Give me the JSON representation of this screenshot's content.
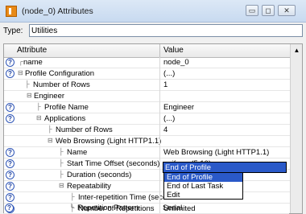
{
  "window": {
    "title": "(node_0) Attributes",
    "minimize": "▭",
    "maximize": "◻",
    "close": "✕"
  },
  "typebar": {
    "label": "Type:",
    "value": "Utilities"
  },
  "grid": {
    "col_attribute": "Attribute",
    "col_value": "Value",
    "rows": [
      {
        "attr": "name",
        "value": "node_0"
      },
      {
        "attr": "Profile Configuration",
        "value": "(...)"
      },
      {
        "attr": "Number of Rows",
        "value": "1"
      },
      {
        "attr": "Engineer",
        "value": ""
      },
      {
        "attr": "Profile Name",
        "value": "Engineer"
      },
      {
        "attr": "Applications",
        "value": "(...)"
      },
      {
        "attr": "Number of Rows",
        "value": "4"
      },
      {
        "attr": "Web Browsing (Light HTTP1.1)",
        "value": ""
      },
      {
        "attr": "Name",
        "value": "Web Browsing (Light HTTP1.1)"
      },
      {
        "attr": "Start Time Offset (seconds)",
        "value": "uniform (5,10)"
      },
      {
        "attr": "Duration (seconds)",
        "value": "End of Profile"
      },
      {
        "attr": "Repeatability",
        "value": ""
      },
      {
        "attr": "Inter-repetition Time (secon...",
        "value": ""
      },
      {
        "attr": "Number of Repetitions",
        "value": "Unlimited"
      },
      {
        "attr": "Repetition Pattern",
        "value": "Serial"
      }
    ]
  },
  "dropdown": {
    "options": [
      "End of Profile",
      "End of Last Task",
      "Edit"
    ]
  }
}
